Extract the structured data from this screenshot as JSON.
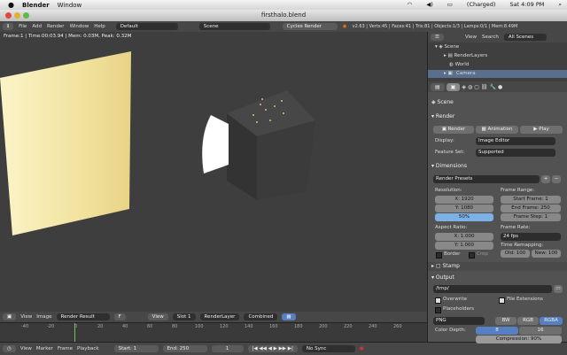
{
  "mac_menu": {
    "app": "Blender",
    "window": "Window",
    "clock": "Sat 4:09 PM",
    "battery": "(Charged)"
  },
  "window_title": "firsthalo.blend",
  "info_header": {
    "menus": [
      "File",
      "Add",
      "Render",
      "Window",
      "Help"
    ],
    "layout": "Default",
    "scene": "Scene",
    "engine": "Cycles Render",
    "stats": "v2.63 | Verts:45 | Faces:41 | Tris:81 | Objects:1/3 | Lamps:0/1 | Mem:8.49M"
  },
  "viewport": {
    "frame_info": "Frame:1 | Time:00:03.94 | Mem: 0.03M, Peak: 0.32M"
  },
  "image_header": {
    "menus": [
      "View",
      "Image"
    ],
    "image": "Render Result",
    "f_label": "F",
    "view": "View",
    "slot": "Slot 1",
    "layer": "RenderLayer",
    "pass": "Combined"
  },
  "timeline": {
    "ticks": [
      "-40",
      "-20",
      "0",
      "20",
      "40",
      "60",
      "80",
      "100",
      "120",
      "140",
      "160",
      "180",
      "200",
      "220",
      "240",
      "260"
    ],
    "menus": [
      "View",
      "Marker",
      "Frame",
      "Playback"
    ],
    "start": "Start: 1",
    "end": "End: 250",
    "current": "1",
    "sync": "No Sync"
  },
  "outliner": {
    "menus": [
      "View",
      "Search"
    ],
    "filter": "All Scenes",
    "items": [
      "Scene",
      "RenderLayers",
      "World",
      "Camera"
    ]
  },
  "properties": {
    "scene_label": "Scene",
    "render": {
      "header": "Render",
      "render_btn": "Render",
      "animation_btn": "Animation",
      "play_btn": "Play",
      "display_label": "Display:",
      "display_value": "Image Editor",
      "feature_label": "Feature Set:",
      "feature_value": "Supported"
    },
    "dimensions": {
      "header": "Dimensions",
      "presets": "Render Presets",
      "resolution_label": "Resolution:",
      "res_x": "X: 1920",
      "res_y": "Y: 1080",
      "res_pct": "50%",
      "frame_range_label": "Frame Range:",
      "start_frame": "Start Frame: 1",
      "end_frame": "End Frame: 250",
      "frame_step": "Frame Step: 1",
      "aspect_label": "Aspect Ratio:",
      "aspect_x": "X: 1.000",
      "aspect_y": "Y: 1.000",
      "border": "Border",
      "crop": "Crop",
      "frame_rate_label": "Frame Rate:",
      "frame_rate": "24 fps",
      "time_remap_label": "Time Remapping:",
      "old": "Old: 100",
      "new": "New: 100"
    },
    "stamp_header": "Stamp",
    "output": {
      "header": "Output",
      "path": "/tmp/",
      "overwrite": "Overwrite",
      "file_ext": "File Extensions",
      "placeholders": "Placeholders",
      "format": "PNG",
      "bw": "BW",
      "rgb": "RGB",
      "rgba": "RGBA",
      "color_depth_label": "Color Depth:",
      "depth_8": "8",
      "depth_16": "16",
      "compression": "Compression: 90%"
    }
  }
}
